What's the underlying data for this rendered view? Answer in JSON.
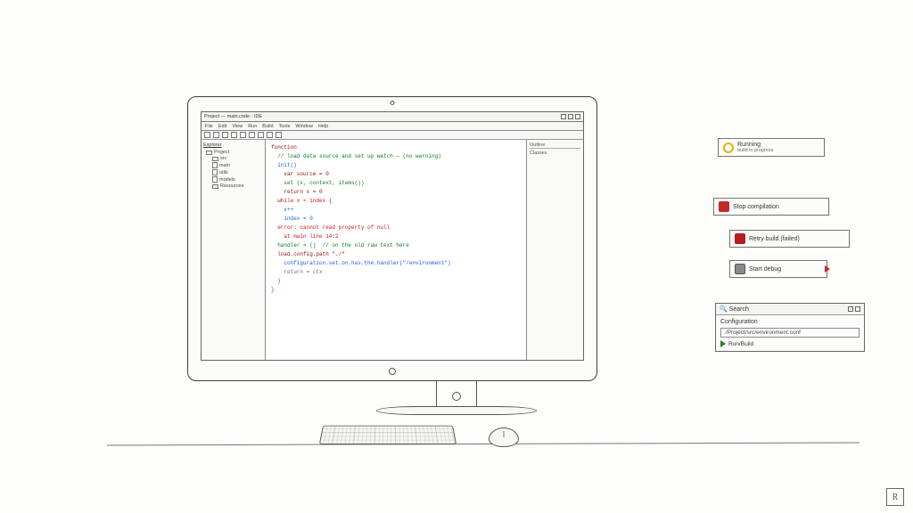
{
  "ide": {
    "title": "Project — main.code - IDE",
    "menu": [
      "File",
      "Edit",
      "View",
      "Run",
      "Build",
      "Tools",
      "Window",
      "Help"
    ],
    "explorer": {
      "header": "Explorer",
      "project": "Project",
      "items": [
        {
          "label": "src",
          "type": "folder"
        },
        {
          "label": "main",
          "type": "file"
        },
        {
          "label": "utils",
          "type": "file"
        },
        {
          "label": "models",
          "type": "file"
        },
        {
          "label": "Resources",
          "type": "folder"
        }
      ]
    },
    "right_pane": {
      "title": "Outline",
      "item": "Classes"
    },
    "code": {
      "l1": "function",
      "l2": "  // load data source and set up watch — (no warning)",
      "l3": "  init()",
      "l4": "    var source = 0",
      "l5": "    set (x, context, items())",
      "l6": "    return x = 0",
      "l7": "  while x < index {",
      "l8": "    x++",
      "l9": "    index = 0",
      "l10": "  error: cannot read property of null",
      "l11": "    at main line 14:2",
      "l12": "",
      "l13": "  handler = ()  // on the old raw text here",
      "l14": "  load.config.path \"./\"",
      "l15": "    configuration.set.on.has.the.handler(\"/environment\")",
      "l16": "    return = ctx",
      "l17": "  }",
      "l18": "}"
    }
  },
  "callouts": {
    "c1": {
      "title": "Running",
      "sub": "build in progress"
    },
    "c2": {
      "label": "Stop compilation"
    },
    "c3": {
      "label": "Retry build (failed)"
    },
    "c4": {
      "label": "Start debug"
    }
  },
  "panel": {
    "title": "Search",
    "label": "Configuration",
    "input_value": "./Project/src/environment.conf",
    "run": "Run/Build"
  },
  "signature": "R"
}
